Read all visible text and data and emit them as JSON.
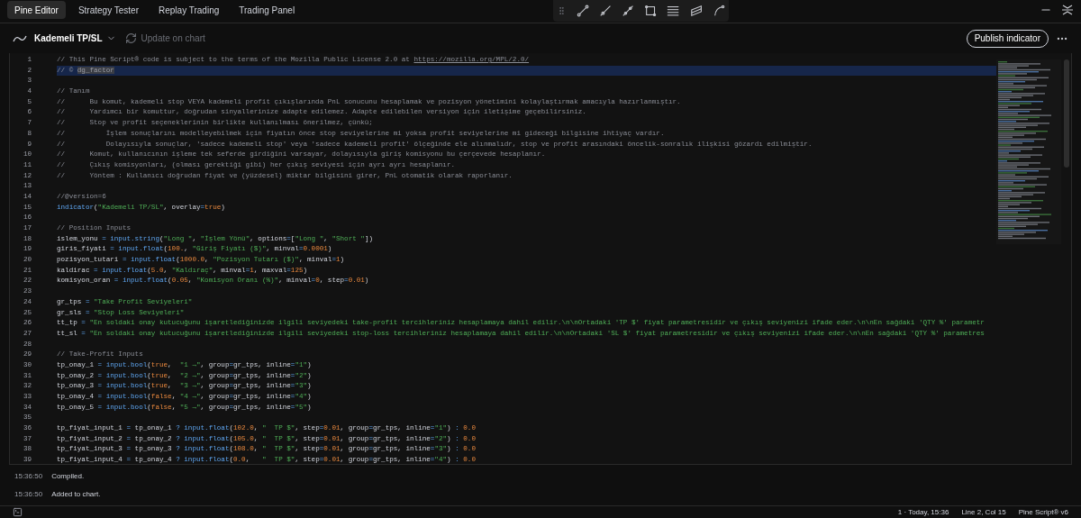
{
  "tabs": [
    {
      "label": "Pine Editor",
      "selected": true
    },
    {
      "label": "Strategy Tester",
      "selected": false
    },
    {
      "label": "Replay Trading",
      "selected": false
    },
    {
      "label": "Trading Panel",
      "selected": false
    }
  ],
  "toolbar": {
    "script_name": "Kademeli TP/SL",
    "update_label": "Update on chart",
    "update_disabled": true,
    "publish_label": "Publish indicator"
  },
  "editor": {
    "lines": [
      {
        "number": "1",
        "current": false,
        "segments": [
          {
            "kind": "comment",
            "text": "// This Pine Script® code is subject to the terms of the Mozilla Public License 2.0 at "
          },
          {
            "kind": "link",
            "text": "https://mozilla.org/MPL/2.0/"
          }
        ]
      },
      {
        "number": "2",
        "current": true,
        "segments": [
          {
            "kind": "comment",
            "text": "// © "
          },
          {
            "kind": "selection",
            "text": "dg_factor"
          }
        ]
      },
      {
        "number": "3",
        "current": false
      },
      {
        "number": "4",
        "current": false,
        "segments": [
          {
            "kind": "comment",
            "text": "// Tanım"
          }
        ]
      },
      {
        "number": "5",
        "current": false,
        "segments": [
          {
            "kind": "comment",
            "text": "//      Bu komut, kademeli stop VEYA kademeli profit çıkışlarında PnL sonucunu hesaplamak ve pozisyon yönetimini kolaylaştırmak amacıyla hazırlanmıştır."
          }
        ]
      },
      {
        "number": "6",
        "current": false,
        "segments": [
          {
            "kind": "comment",
            "text": "//      Yardımcı bir komuttur, doğrudan sinyallerinize adapte edilemez. Adapte edilebilen versiyon için iletişime geçebilirsiniz."
          }
        ]
      },
      {
        "number": "7",
        "current": false,
        "segments": [
          {
            "kind": "comment",
            "text": "//      Stop ve profit seçeneklerinin birlikte kullanılması önerilmez, çünkü;"
          }
        ]
      },
      {
        "number": "8",
        "current": false,
        "segments": [
          {
            "kind": "comment",
            "text": "//          İşlem sonuçlarını modelleyebilmek için fiyatın önce stop seviyelerine mi yoksa profit seviyelerine mi gideceği bilgisine ihtiyaç vardır."
          }
        ]
      },
      {
        "number": "9",
        "current": false,
        "segments": [
          {
            "kind": "comment",
            "text": "//          Dolayısıyla sonuçlar, 'sadece kademeli stop' veya 'sadece kademeli profit' ölçeğinde ele alınmalıdr, stop ve profit arasındaki öncelik-sonralık ilişkisi gözardı edilmiştir."
          }
        ]
      },
      {
        "number": "10",
        "current": false,
        "segments": [
          {
            "kind": "comment",
            "text": "//      Komut, kullanıcının işleme tek seferde girdiğini varsayar, dolayısıyla giriş komisyonu bu çerçevede hesaplanır."
          }
        ]
      },
      {
        "number": "11",
        "current": false,
        "segments": [
          {
            "kind": "comment",
            "text": "//      Çıkış komisyonları, (olması gerektiği gibi) her çıkış seviyesi için ayrı ayrı hesaplanır."
          }
        ]
      },
      {
        "number": "12",
        "current": false,
        "segments": [
          {
            "kind": "comment",
            "text": "//      Yöntem : Kullanıcı doğrudan fiyat ve (yüzdesel) miktar bilgisini girer, PnL otomatik olarak raporlanır."
          }
        ]
      },
      {
        "number": "13",
        "current": false
      },
      {
        "number": "14",
        "current": false,
        "segments": [
          {
            "kind": "comment",
            "text": "//@version=6"
          }
        ]
      },
      {
        "number": "15",
        "current": false,
        "segments": [
          {
            "kind": "func",
            "text": "indicator"
          },
          {
            "kind": "plain",
            "text": "("
          },
          {
            "kind": "string",
            "text": "\"Kademeli TP/SL\""
          },
          {
            "kind": "plain",
            "text": ", overlay"
          },
          {
            "kind": "op",
            "text": "="
          },
          {
            "kind": "number",
            "text": "true"
          },
          {
            "kind": "plain",
            "text": ")"
          }
        ]
      },
      {
        "number": "16",
        "current": false
      },
      {
        "number": "17",
        "current": false,
        "segments": [
          {
            "kind": "comment",
            "text": "// Position Inputs"
          }
        ]
      },
      {
        "number": "18",
        "current": false,
        "segments": [
          {
            "kind": "plain",
            "text": "islem_yonu "
          },
          {
            "kind": "op",
            "text": "="
          },
          {
            "kind": "func",
            "text": " input.string"
          },
          {
            "kind": "plain",
            "text": "("
          },
          {
            "kind": "string",
            "text": "\"Long \""
          },
          {
            "kind": "plain",
            "text": ", "
          },
          {
            "kind": "string",
            "text": "\"İşlem Yönü\""
          },
          {
            "kind": "plain",
            "text": ", options"
          },
          {
            "kind": "op",
            "text": "="
          },
          {
            "kind": "plain",
            "text": "["
          },
          {
            "kind": "string",
            "text": "\"Long \""
          },
          {
            "kind": "plain",
            "text": ", "
          },
          {
            "kind": "string",
            "text": "\"Short \""
          },
          {
            "kind": "plain",
            "text": "])"
          }
        ]
      },
      {
        "number": "19",
        "current": false,
        "segments": [
          {
            "kind": "plain",
            "text": "giris_fiyati "
          },
          {
            "kind": "op",
            "text": "="
          },
          {
            "kind": "func",
            "text": " input.float"
          },
          {
            "kind": "plain",
            "text": "("
          },
          {
            "kind": "number",
            "text": "100."
          },
          {
            "kind": "plain",
            "text": ", "
          },
          {
            "kind": "string",
            "text": "\"Giriş Fiyatı ($)\""
          },
          {
            "kind": "plain",
            "text": ", minval"
          },
          {
            "kind": "op",
            "text": "="
          },
          {
            "kind": "number",
            "text": "0.0001"
          },
          {
            "kind": "plain",
            "text": ")"
          }
        ]
      },
      {
        "number": "20",
        "current": false,
        "segments": [
          {
            "kind": "plain",
            "text": "pozisyon_tutari "
          },
          {
            "kind": "op",
            "text": "="
          },
          {
            "kind": "func",
            "text": " input.float"
          },
          {
            "kind": "plain",
            "text": "("
          },
          {
            "kind": "number",
            "text": "1000.0"
          },
          {
            "kind": "plain",
            "text": ", "
          },
          {
            "kind": "string",
            "text": "\"Pozisyon Tutarı ($)\""
          },
          {
            "kind": "plain",
            "text": ", minval"
          },
          {
            "kind": "op",
            "text": "="
          },
          {
            "kind": "number",
            "text": "1"
          },
          {
            "kind": "plain",
            "text": ")"
          }
        ]
      },
      {
        "number": "21",
        "current": false,
        "segments": [
          {
            "kind": "plain",
            "text": "kaldirac "
          },
          {
            "kind": "op",
            "text": "="
          },
          {
            "kind": "func",
            "text": " input.float"
          },
          {
            "kind": "plain",
            "text": "("
          },
          {
            "kind": "number",
            "text": "5.0"
          },
          {
            "kind": "plain",
            "text": ", "
          },
          {
            "kind": "string",
            "text": "\"Kaldıraç\""
          },
          {
            "kind": "plain",
            "text": ", minval"
          },
          {
            "kind": "op",
            "text": "="
          },
          {
            "kind": "number",
            "text": "1"
          },
          {
            "kind": "plain",
            "text": ", maxval"
          },
          {
            "kind": "op",
            "text": "="
          },
          {
            "kind": "number",
            "text": "125"
          },
          {
            "kind": "plain",
            "text": ")"
          }
        ]
      },
      {
        "number": "22",
        "current": false,
        "segments": [
          {
            "kind": "plain",
            "text": "komisyon_oran "
          },
          {
            "kind": "op",
            "text": "="
          },
          {
            "kind": "func",
            "text": " input.float"
          },
          {
            "kind": "plain",
            "text": "("
          },
          {
            "kind": "number",
            "text": "0.05"
          },
          {
            "kind": "plain",
            "text": ", "
          },
          {
            "kind": "string",
            "text": "\"Komisyon Oranı (%)\""
          },
          {
            "kind": "plain",
            "text": ", minval"
          },
          {
            "kind": "op",
            "text": "="
          },
          {
            "kind": "number",
            "text": "0"
          },
          {
            "kind": "plain",
            "text": ", step"
          },
          {
            "kind": "op",
            "text": "="
          },
          {
            "kind": "number",
            "text": "0.01"
          },
          {
            "kind": "plain",
            "text": ")"
          }
        ]
      },
      {
        "number": "23",
        "current": false
      },
      {
        "number": "24",
        "current": false,
        "segments": [
          {
            "kind": "plain",
            "text": "gr_tps "
          },
          {
            "kind": "op",
            "text": "="
          },
          {
            "kind": "string",
            "text": " \"Take Profit Seviyeleri\""
          }
        ]
      },
      {
        "number": "25",
        "current": false,
        "segments": [
          {
            "kind": "plain",
            "text": "gr_sls "
          },
          {
            "kind": "op",
            "text": "="
          },
          {
            "kind": "string",
            "text": " \"Stop Loss Seviyeleri\""
          }
        ]
      },
      {
        "number": "26",
        "current": false,
        "segments": [
          {
            "kind": "plain",
            "text": "tt_tp "
          },
          {
            "kind": "op",
            "text": "="
          },
          {
            "kind": "string",
            "text": " \"En soldaki onay kutucuğunu işaretlediğinizde ilgili seviyedeki take-profit tercihleriniz hesaplamaya dahil edilir.\\n\\nOrtadaki 'TP $' fiyat parametresidir ve çıkış seviyenizi ifade eder.\\n\\nEn sağdaki 'QTY %' parametr"
          }
        ]
      },
      {
        "number": "27",
        "current": false,
        "segments": [
          {
            "kind": "plain",
            "text": "tt_sl "
          },
          {
            "kind": "op",
            "text": "="
          },
          {
            "kind": "string",
            "text": " \"En soldaki onay kutucuğunu işaretlediğinizde ilgili seviyedeki stop-loss tercihleriniz hesaplamaya dahil edilir.\\n\\nOrtadaki 'SL $' fiyat parametresidir ve çıkış seviyenizi ifade eder.\\n\\nEn sağdaki 'QTY %' parametres"
          }
        ]
      },
      {
        "number": "28",
        "current": false
      },
      {
        "number": "29",
        "current": false,
        "segments": [
          {
            "kind": "comment",
            "text": "// Take-Profit Inputs"
          }
        ]
      },
      {
        "number": "30",
        "current": false,
        "segments": [
          {
            "kind": "plain",
            "text": "tp_onay_1 "
          },
          {
            "kind": "op",
            "text": "="
          },
          {
            "kind": "func",
            "text": " input.bool"
          },
          {
            "kind": "plain",
            "text": "("
          },
          {
            "kind": "number",
            "text": "true"
          },
          {
            "kind": "plain",
            "text": ",  "
          },
          {
            "kind": "string",
            "text": "\"1 →\""
          },
          {
            "kind": "plain",
            "text": ", group"
          },
          {
            "kind": "op",
            "text": "="
          },
          {
            "kind": "plain",
            "text": "gr_tps, inline"
          },
          {
            "kind": "op",
            "text": "="
          },
          {
            "kind": "string",
            "text": "\"1\""
          },
          {
            "kind": "plain",
            "text": ")"
          }
        ]
      },
      {
        "number": "31",
        "current": false,
        "segments": [
          {
            "kind": "plain",
            "text": "tp_onay_2 "
          },
          {
            "kind": "op",
            "text": "="
          },
          {
            "kind": "func",
            "text": " input.bool"
          },
          {
            "kind": "plain",
            "text": "("
          },
          {
            "kind": "number",
            "text": "true"
          },
          {
            "kind": "plain",
            "text": ",  "
          },
          {
            "kind": "string",
            "text": "\"2 →\""
          },
          {
            "kind": "plain",
            "text": ", group"
          },
          {
            "kind": "op",
            "text": "="
          },
          {
            "kind": "plain",
            "text": "gr_tps, inline"
          },
          {
            "kind": "op",
            "text": "="
          },
          {
            "kind": "string",
            "text": "\"2\""
          },
          {
            "kind": "plain",
            "text": ")"
          }
        ]
      },
      {
        "number": "32",
        "current": false,
        "segments": [
          {
            "kind": "plain",
            "text": "tp_onay_3 "
          },
          {
            "kind": "op",
            "text": "="
          },
          {
            "kind": "func",
            "text": " input.bool"
          },
          {
            "kind": "plain",
            "text": "("
          },
          {
            "kind": "number",
            "text": "true"
          },
          {
            "kind": "plain",
            "text": ",  "
          },
          {
            "kind": "string",
            "text": "\"3 →\""
          },
          {
            "kind": "plain",
            "text": ", group"
          },
          {
            "kind": "op",
            "text": "="
          },
          {
            "kind": "plain",
            "text": "gr_tps, inline"
          },
          {
            "kind": "op",
            "text": "="
          },
          {
            "kind": "string",
            "text": "\"3\""
          },
          {
            "kind": "plain",
            "text": ")"
          }
        ]
      },
      {
        "number": "33",
        "current": false,
        "segments": [
          {
            "kind": "plain",
            "text": "tp_onay_4 "
          },
          {
            "kind": "op",
            "text": "="
          },
          {
            "kind": "func",
            "text": " input.bool"
          },
          {
            "kind": "plain",
            "text": "("
          },
          {
            "kind": "number",
            "text": "false"
          },
          {
            "kind": "plain",
            "text": ", "
          },
          {
            "kind": "string",
            "text": "\"4 →\""
          },
          {
            "kind": "plain",
            "text": ", group"
          },
          {
            "kind": "op",
            "text": "="
          },
          {
            "kind": "plain",
            "text": "gr_tps, inline"
          },
          {
            "kind": "op",
            "text": "="
          },
          {
            "kind": "string",
            "text": "\"4\""
          },
          {
            "kind": "plain",
            "text": ")"
          }
        ]
      },
      {
        "number": "34",
        "current": false,
        "segments": [
          {
            "kind": "plain",
            "text": "tp_onay_5 "
          },
          {
            "kind": "op",
            "text": "="
          },
          {
            "kind": "func",
            "text": " input.bool"
          },
          {
            "kind": "plain",
            "text": "("
          },
          {
            "kind": "number",
            "text": "false"
          },
          {
            "kind": "plain",
            "text": ", "
          },
          {
            "kind": "string",
            "text": "\"5 →\""
          },
          {
            "kind": "plain",
            "text": ", group"
          },
          {
            "kind": "op",
            "text": "="
          },
          {
            "kind": "plain",
            "text": "gr_tps, inline"
          },
          {
            "kind": "op",
            "text": "="
          },
          {
            "kind": "string",
            "text": "\"5\""
          },
          {
            "kind": "plain",
            "text": ")"
          }
        ]
      },
      {
        "number": "35",
        "current": false
      },
      {
        "number": "36",
        "current": false,
        "segments": [
          {
            "kind": "plain",
            "text": "tp_fiyat_input_1 "
          },
          {
            "kind": "op",
            "text": "="
          },
          {
            "kind": "plain",
            "text": " tp_onay_1 "
          },
          {
            "kind": "op",
            "text": "?"
          },
          {
            "kind": "func",
            "text": " input.float"
          },
          {
            "kind": "plain",
            "text": "("
          },
          {
            "kind": "number",
            "text": "102.0"
          },
          {
            "kind": "plain",
            "text": ", "
          },
          {
            "kind": "string",
            "text": "\"  TP $\""
          },
          {
            "kind": "plain",
            "text": ", step"
          },
          {
            "kind": "op",
            "text": "="
          },
          {
            "kind": "number",
            "text": "0.01"
          },
          {
            "kind": "plain",
            "text": ", group"
          },
          {
            "kind": "op",
            "text": "="
          },
          {
            "kind": "plain",
            "text": "gr_tps, inline"
          },
          {
            "kind": "op",
            "text": "="
          },
          {
            "kind": "string",
            "text": "\"1\""
          },
          {
            "kind": "plain",
            "text": ") "
          },
          {
            "kind": "op",
            "text": ":"
          },
          {
            "kind": "number",
            "text": " 0.0"
          }
        ]
      },
      {
        "number": "37",
        "current": false,
        "segments": [
          {
            "kind": "plain",
            "text": "tp_fiyat_input_2 "
          },
          {
            "kind": "op",
            "text": "="
          },
          {
            "kind": "plain",
            "text": " tp_onay_2 "
          },
          {
            "kind": "op",
            "text": "?"
          },
          {
            "kind": "func",
            "text": " input.float"
          },
          {
            "kind": "plain",
            "text": "("
          },
          {
            "kind": "number",
            "text": "105.0"
          },
          {
            "kind": "plain",
            "text": ", "
          },
          {
            "kind": "string",
            "text": "\"  TP $\""
          },
          {
            "kind": "plain",
            "text": ", step"
          },
          {
            "kind": "op",
            "text": "="
          },
          {
            "kind": "number",
            "text": "0.01"
          },
          {
            "kind": "plain",
            "text": ", group"
          },
          {
            "kind": "op",
            "text": "="
          },
          {
            "kind": "plain",
            "text": "gr_tps, inline"
          },
          {
            "kind": "op",
            "text": "="
          },
          {
            "kind": "string",
            "text": "\"2\""
          },
          {
            "kind": "plain",
            "text": ") "
          },
          {
            "kind": "op",
            "text": ":"
          },
          {
            "kind": "number",
            "text": " 0.0"
          }
        ]
      },
      {
        "number": "38",
        "current": false,
        "segments": [
          {
            "kind": "plain",
            "text": "tp_fiyat_input_3 "
          },
          {
            "kind": "op",
            "text": "="
          },
          {
            "kind": "plain",
            "text": " tp_onay_3 "
          },
          {
            "kind": "op",
            "text": "?"
          },
          {
            "kind": "func",
            "text": " input.float"
          },
          {
            "kind": "plain",
            "text": "("
          },
          {
            "kind": "number",
            "text": "108.0"
          },
          {
            "kind": "plain",
            "text": ", "
          },
          {
            "kind": "string",
            "text": "\"  TP $\""
          },
          {
            "kind": "plain",
            "text": ", step"
          },
          {
            "kind": "op",
            "text": "="
          },
          {
            "kind": "number",
            "text": "0.01"
          },
          {
            "kind": "plain",
            "text": ", group"
          },
          {
            "kind": "op",
            "text": "="
          },
          {
            "kind": "plain",
            "text": "gr_tps, inline"
          },
          {
            "kind": "op",
            "text": "="
          },
          {
            "kind": "string",
            "text": "\"3\""
          },
          {
            "kind": "plain",
            "text": ") "
          },
          {
            "kind": "op",
            "text": ":"
          },
          {
            "kind": "number",
            "text": " 0.0"
          }
        ]
      },
      {
        "number": "39",
        "current": false,
        "segments": [
          {
            "kind": "plain",
            "text": "tp_fiyat_input_4 "
          },
          {
            "kind": "op",
            "text": "="
          },
          {
            "kind": "plain",
            "text": " tp_onay_4 "
          },
          {
            "kind": "op",
            "text": "?"
          },
          {
            "kind": "func",
            "text": " input.float"
          },
          {
            "kind": "plain",
            "text": "("
          },
          {
            "kind": "number",
            "text": "0.0"
          },
          {
            "kind": "plain",
            "text": ",   "
          },
          {
            "kind": "string",
            "text": "\"  TP $\""
          },
          {
            "kind": "plain",
            "text": ", step"
          },
          {
            "kind": "op",
            "text": "="
          },
          {
            "kind": "number",
            "text": "0.01"
          },
          {
            "kind": "plain",
            "text": ", group"
          },
          {
            "kind": "op",
            "text": "="
          },
          {
            "kind": "plain",
            "text": "gr_tps, inline"
          },
          {
            "kind": "op",
            "text": "="
          },
          {
            "kind": "string",
            "text": "\"4\""
          },
          {
            "kind": "plain",
            "text": ") "
          },
          {
            "kind": "op",
            "text": ":"
          },
          {
            "kind": "number",
            "text": " 0.0"
          }
        ]
      }
    ]
  },
  "console": [
    {
      "time": "15:36:50",
      "message": "Compiled."
    },
    {
      "time": "15:36:50",
      "message": "Added to chart."
    }
  ],
  "status_bar": {
    "changes": "1 · Today, 15:36",
    "cursor": "Line 2, Col 15",
    "language": "Pine Script® v6"
  }
}
